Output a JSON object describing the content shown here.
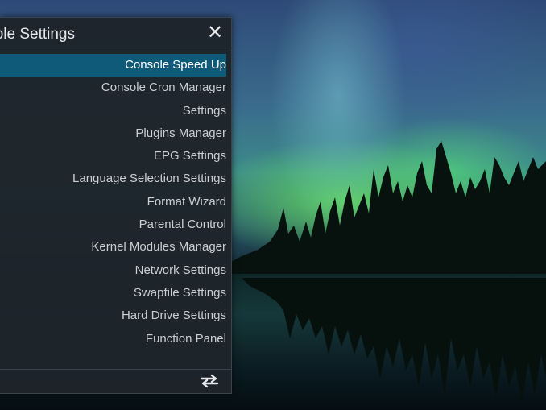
{
  "panel": {
    "title": "Console Settings",
    "close_icon": "close-icon",
    "items": [
      {
        "label": "Console Speed Up",
        "selected": true
      },
      {
        "label": "Console Cron Manager",
        "selected": false
      },
      {
        "label": "Settings",
        "selected": false
      },
      {
        "label": "Plugins Manager",
        "selected": false
      },
      {
        "label": "EPG Settings",
        "selected": false
      },
      {
        "label": "Language Selection Settings",
        "selected": false
      },
      {
        "label": "Format Wizard",
        "selected": false
      },
      {
        "label": "Parental Control",
        "selected": false
      },
      {
        "label": "Kernel Modules Manager",
        "selected": false
      },
      {
        "label": "Network Settings",
        "selected": false
      },
      {
        "label": "Swapfile Settings",
        "selected": false
      },
      {
        "label": "Hard Drive Settings",
        "selected": false
      },
      {
        "label": "Function Panel",
        "selected": false
      }
    ],
    "footer_icon": "swap-arrows-icon",
    "selected_color": "#0e5a78"
  }
}
